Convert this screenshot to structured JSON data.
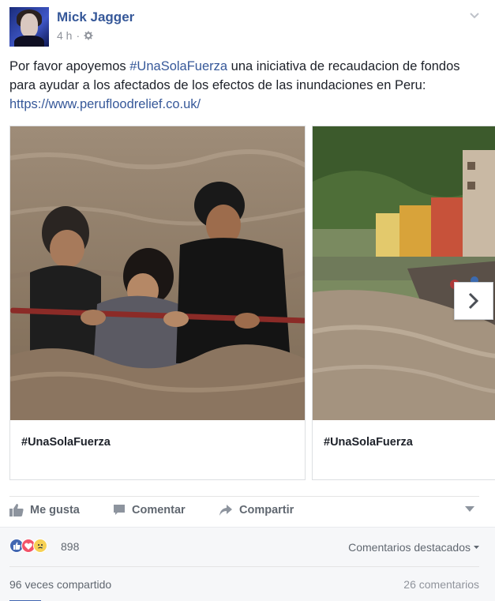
{
  "post": {
    "author": "Mick Jagger",
    "time": "4 h",
    "separator": "·",
    "text_before": "Por favor apoyemos ",
    "hashtag": "#UnaSolaFuerza",
    "text_middle": " una iniciativa de recaudacion de fondos para ayudar a los afectados de los efectos de las inundaciones en Peru: ",
    "link": "https://www.perufloodrelief.co.uk/"
  },
  "carousel": {
    "cards": [
      {
        "caption": "#UnaSolaFuerza"
      },
      {
        "caption": "#UnaSolaFuerza"
      }
    ]
  },
  "actions": {
    "like": "Me gusta",
    "comment": "Comentar",
    "share": "Compartir"
  },
  "reactions": {
    "count": "898",
    "top_comments": "Comentarios destacados",
    "shares": "96 veces compartido",
    "comments": "26 comentarios"
  },
  "colors": {
    "link_blue": "#365899",
    "like_blue": "#4267b2",
    "love_red": "#f25268",
    "sad_yellow": "#f7d154",
    "muted": "#606770"
  }
}
